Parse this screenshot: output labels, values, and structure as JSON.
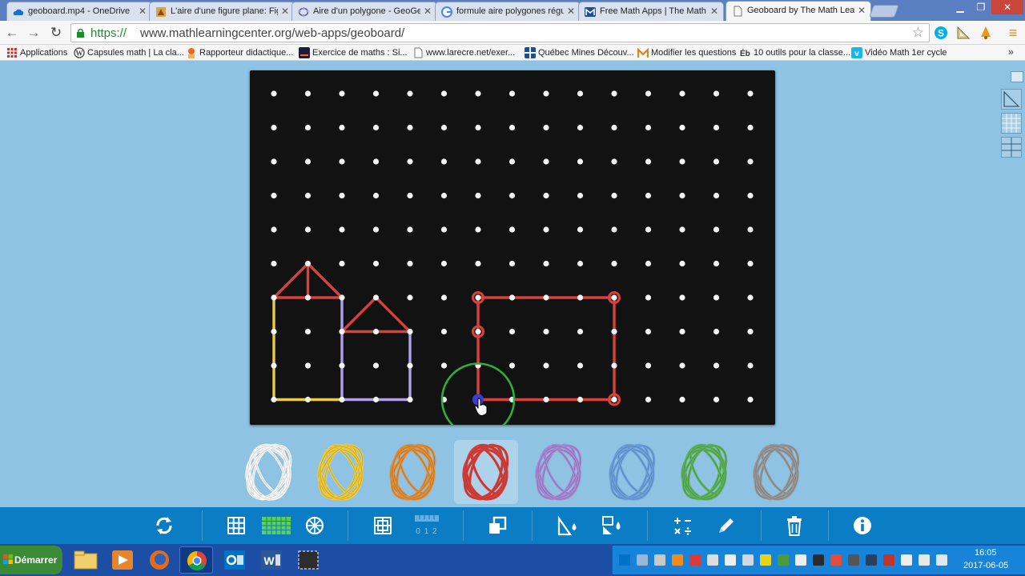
{
  "browser": {
    "tabs": [
      {
        "title": "geoboard.mp4 - OneDrive",
        "icon": "onedrive-cloud-icon",
        "active": false
      },
      {
        "title": "L'aire d'une figure plane: Fig",
        "icon": "page-icon",
        "active": false
      },
      {
        "title": "Aire d'un polygone - GeoGeb",
        "icon": "geogebra-icon",
        "active": false
      },
      {
        "title": "formule aire polygones réguli",
        "icon": "google-icon",
        "active": false
      },
      {
        "title": "Free Math Apps | The Math L",
        "icon": "mlc-icon",
        "active": false
      },
      {
        "title": "Geoboard by The Math Learn",
        "icon": "document-icon",
        "active": true
      }
    ],
    "url_scheme": "https://",
    "url_rest": "www.mathlearningcenter.org/web-apps/geoboard/",
    "bookmarks": [
      {
        "label": "Applications",
        "icon": "apps-grid-icon"
      },
      {
        "label": "Capsules math | La cla...",
        "icon": "wordpress-icon"
      },
      {
        "label": "Rapporteur didactique...",
        "icon": "person-icon"
      },
      {
        "label": "Exercice de maths : Si...",
        "icon": "dark-square-icon"
      },
      {
        "label": "www.larecre.net/exer...",
        "icon": "page-icon"
      },
      {
        "label": "Québec Mines Découv...",
        "icon": "quebec-flag-icon"
      },
      {
        "label": "Modifier les questions",
        "icon": "m-logo-icon"
      },
      {
        "label": "10 outils pour la classe...",
        "icon": "eb-icon"
      },
      {
        "label": "Vidéo Math 1er cycle",
        "icon": "vimeo-icon"
      }
    ],
    "bookmark_more": "»"
  },
  "geoboard": {
    "grid_cols": 15,
    "grid_rows": 10,
    "cursor_peg": [
      6,
      9
    ],
    "bands": [
      {
        "color": "#e8cc4a",
        "closed": false,
        "pegs": [
          [
            0,
            6
          ],
          [
            0,
            9
          ],
          [
            2,
            9
          ]
        ]
      },
      {
        "color": "#b0a0ea",
        "closed": false,
        "pegs": [
          [
            2,
            6
          ],
          [
            2,
            9
          ],
          [
            4,
            9
          ],
          [
            4,
            7
          ]
        ]
      },
      {
        "color": "#d9413c",
        "closed": true,
        "pegs": [
          [
            0,
            6
          ],
          [
            1,
            5
          ],
          [
            2,
            6
          ]
        ]
      },
      {
        "color": "#d9413c",
        "closed": false,
        "pegs": [
          [
            1,
            5
          ],
          [
            1,
            6
          ]
        ]
      },
      {
        "color": "#d9413c",
        "closed": true,
        "pegs": [
          [
            2,
            7
          ],
          [
            3,
            6
          ],
          [
            4,
            7
          ]
        ]
      },
      {
        "color": "#d9413c",
        "closed": false,
        "pegs": [
          [
            6,
            6
          ],
          [
            10,
            6
          ],
          [
            10,
            9
          ],
          [
            6,
            9
          ],
          [
            6,
            7
          ],
          [
            6,
            6
          ]
        ],
        "markers": [
          [
            6,
            6
          ],
          [
            10,
            6
          ],
          [
            6,
            7
          ],
          [
            10,
            9
          ]
        ]
      }
    ],
    "band_palette": [
      {
        "name": "white",
        "color": "#ffffff",
        "selected": false
      },
      {
        "name": "yellow",
        "color": "#f2cc3b",
        "selected": false
      },
      {
        "name": "orange",
        "color": "#e3913a",
        "selected": false
      },
      {
        "name": "red",
        "color": "#d9413c",
        "selected": true
      },
      {
        "name": "purple",
        "color": "#a98cd8",
        "selected": false
      },
      {
        "name": "blue",
        "color": "#6fa3de",
        "selected": false
      },
      {
        "name": "green",
        "color": "#5fb55b",
        "selected": false
      },
      {
        "name": "gray",
        "color": "#9a9a9a",
        "selected": false
      }
    ],
    "toolbar_ruler_label": "0 1 2"
  },
  "taskbar": {
    "start_label": "Démarrer",
    "time": "16:05",
    "date": "2017-06-05"
  }
}
